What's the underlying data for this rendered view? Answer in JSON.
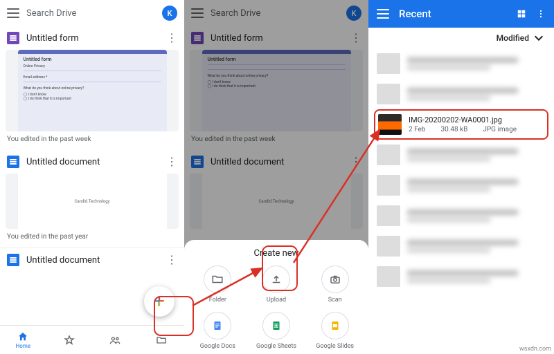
{
  "panel1": {
    "search_placeholder": "Search Drive",
    "avatar": "K",
    "files": [
      {
        "title": "Untitled form",
        "meta": "You edited in the past week",
        "preview_title": "Untitled form"
      },
      {
        "title": "Untitled document",
        "meta": "You edited in the past year",
        "preview_text": "Candid.Technology"
      },
      {
        "title": "Untitled document"
      }
    ],
    "nav": {
      "home": "Home",
      "starred": "",
      "shared": "",
      "files": ""
    }
  },
  "panel2": {
    "search_placeholder": "Search Drive",
    "avatar": "K",
    "files": [
      {
        "title": "Untitled form",
        "meta": "You edited in the past week",
        "preview_title": "Untitled form"
      },
      {
        "title": "Untitled document",
        "preview_text": "Candid.Technology"
      }
    ],
    "sheet_title": "Create new",
    "options": [
      {
        "key": "folder",
        "label": "Folder"
      },
      {
        "key": "upload",
        "label": "Upload"
      },
      {
        "key": "scan",
        "label": "Scan"
      },
      {
        "key": "docs",
        "label": "Google Docs"
      },
      {
        "key": "sheets",
        "label": "Google Sheets"
      },
      {
        "key": "slides",
        "label": "Google Slides"
      }
    ]
  },
  "panel3": {
    "title": "Recent",
    "sort": "Modified",
    "highlight": {
      "filename": "IMG-20200202-WA0001.jpg",
      "date": "2 Feb",
      "size": "30.48 kB",
      "type": "JPG image"
    }
  },
  "watermark": "wsxdn.com"
}
